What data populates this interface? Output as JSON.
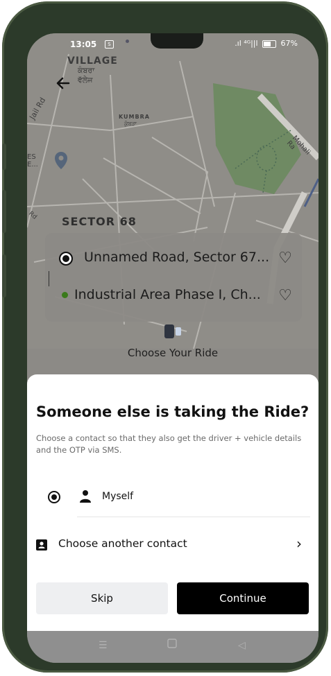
{
  "status_bar": {
    "time": "13:05",
    "sim_label": "Ⓢ",
    "signal": ".ıl ⁴ᴳ||l",
    "battery": "67%"
  },
  "map": {
    "labels": {
      "village": "VILLAGE",
      "village_punjabi_1": "ਕੰਬਰਾ",
      "village_punjabi_2": "ਵੱਲੇਜ",
      "kumbra": "KUMBRA",
      "kumbra_punjabi": "ਕੁੰਬੜਾ",
      "jail_rd": "Jail Rd",
      "sector_68": "SECTOR 68",
      "mohali_rd": "Mohali Ra",
      "es_e": "ES\nE...",
      "rd": "Rd"
    }
  },
  "route": {
    "pickup": "Unnamed Road, Sector 67...",
    "drop": "Industrial Area Phase I, Ch..."
  },
  "choose_ride_label": "Choose Your Ride",
  "sheet": {
    "title": "Someone else is taking the Ride?",
    "subtitle": "Choose a contact so that they also get the driver + vehicle details and the OTP via SMS.",
    "option_myself": "Myself",
    "option_other": "Choose another contact",
    "skip": "Skip",
    "continue": "Continue"
  },
  "colors": {
    "accent": "#000000",
    "secondary_button": "#eeeff1",
    "map_overlay": "#8f8d88",
    "park": "#6f8a63",
    "drop_dot": "#3a7a1b"
  }
}
